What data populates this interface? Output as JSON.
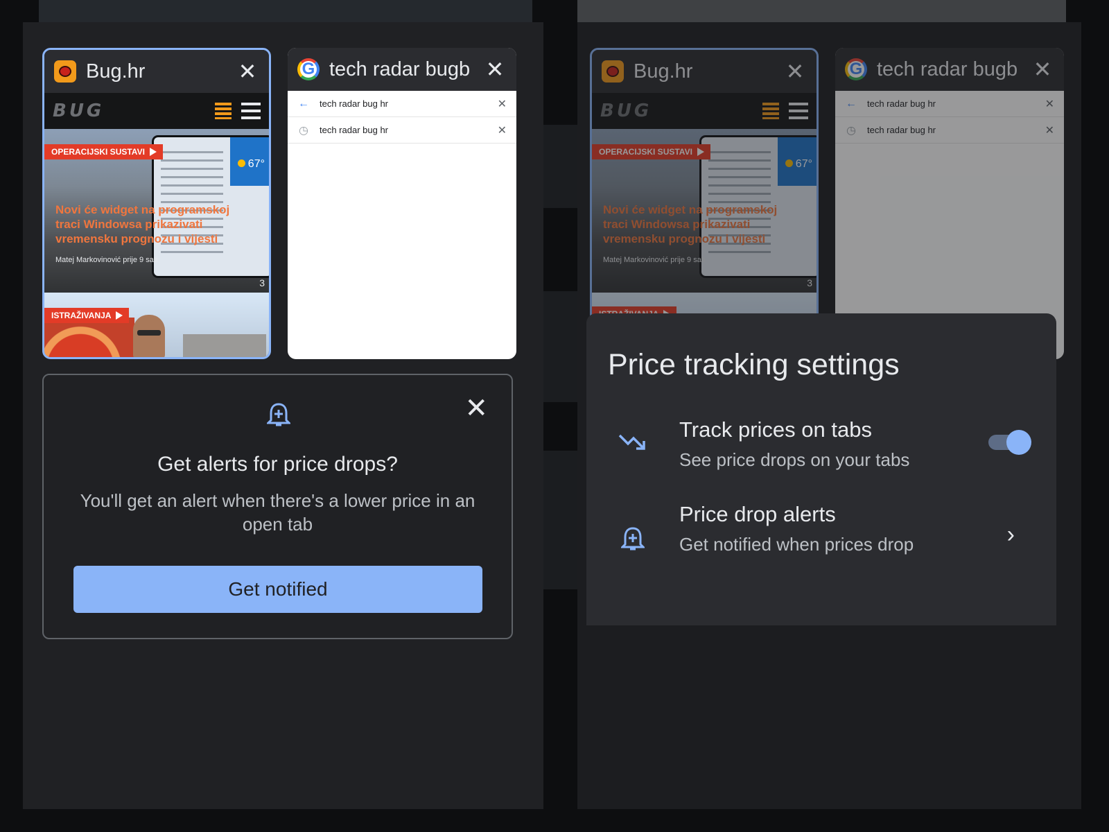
{
  "tabs": [
    {
      "title": "Bug.hr",
      "close": "✕",
      "bug_logo": "BUG",
      "category": "OPERACIJSKI SUSTAVI",
      "headline": "Novi će widget na programskoj traci Windowsa prikazivati vremensku prognozu i vijesti",
      "byline": "Matej Markovinović prije 9 sati",
      "temp": "67°",
      "count": "3",
      "category2": "ISTRAŽIVANJA"
    },
    {
      "title": "tech radar bugb",
      "close": "✕",
      "suggestions": [
        {
          "text": "tech radar bug hr",
          "icon": "back-arrow-icon",
          "x": "✕"
        },
        {
          "text": "tech radar bug hr",
          "icon": "history-icon",
          "x": "✕"
        }
      ]
    }
  ],
  "alert_card": {
    "close": "✕",
    "title": "Get alerts for price drops?",
    "description": "You'll get an alert when there's a lower price in an open tab",
    "button": "Get notified"
  },
  "price_sheet": {
    "title": "Price tracking settings",
    "track": {
      "title": "Track prices on tabs",
      "subtitle": "See price drops on your tabs",
      "enabled": true
    },
    "alerts": {
      "title": "Price drop alerts",
      "subtitle": "Get notified when prices drop",
      "chevron": "›"
    }
  },
  "colors": {
    "accent": "#8ab4f8",
    "panel": "#202124",
    "text": "#e8eaed"
  }
}
